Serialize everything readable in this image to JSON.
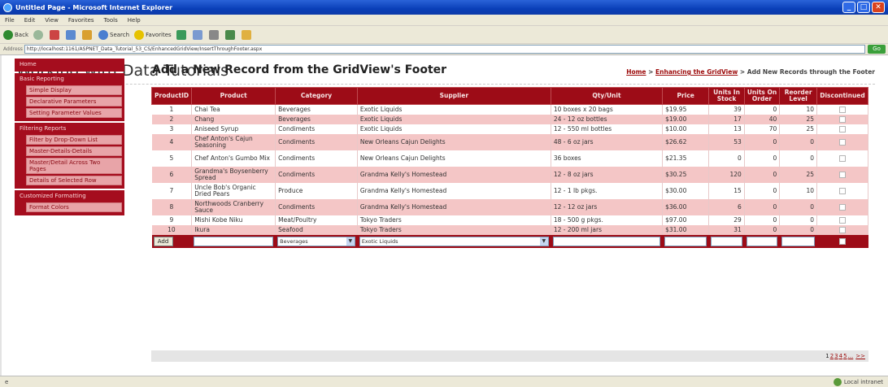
{
  "window": {
    "title": "Untitled Page - Microsoft Internet Explorer"
  },
  "menu": [
    "File",
    "Edit",
    "View",
    "Favorites",
    "Tools",
    "Help"
  ],
  "toolbar": {
    "back": "Back",
    "search": "Search",
    "favorites": "Favorites"
  },
  "address": {
    "label": "Address",
    "url": "http://localhost:1161/ASPNET_Data_Tutorial_53_CS/EnhancedGridView/InsertThroughFooter.aspx",
    "go": "Go"
  },
  "site": {
    "title": "Working with Data Tutorials"
  },
  "breadcrumb": {
    "home": "Home",
    "sep1": " > ",
    "section": "Enhancing the GridView",
    "sep2": " > ",
    "current": "Add New Records through the Footer"
  },
  "sidebar": [
    {
      "label": "Home",
      "children": []
    },
    {
      "label": "Basic Reporting",
      "children": [
        "Simple Display",
        "Declarative Parameters",
        "Setting Parameter Values"
      ]
    },
    {
      "label": "Filtering Reports",
      "children": [
        "Filter by Drop-Down List",
        "Master-Details-Details",
        "Master/Detail Across Two Pages",
        "Details of Selected Row"
      ]
    },
    {
      "label": "Customized Formatting",
      "children": [
        "Format Colors"
      ]
    }
  ],
  "page": {
    "heading": "Add a New Record from the GridView's Footer"
  },
  "grid": {
    "columns": [
      "ProductID",
      "Product",
      "Category",
      "Supplier",
      "Qty/Unit",
      "Price",
      "Units In Stock",
      "Units On Order",
      "Reorder Level",
      "Discontinued"
    ],
    "rows": [
      [
        "1",
        "Chai Tea",
        "Beverages",
        "Exotic Liquids",
        "10 boxes x 20 bags",
        "$19.95",
        "39",
        "0",
        "10"
      ],
      [
        "2",
        "Chang",
        "Beverages",
        "Exotic Liquids",
        "24 - 12 oz bottles",
        "$19.00",
        "17",
        "40",
        "25"
      ],
      [
        "3",
        "Aniseed Syrup",
        "Condiments",
        "Exotic Liquids",
        "12 - 550 ml bottles",
        "$10.00",
        "13",
        "70",
        "25"
      ],
      [
        "4",
        "Chef Anton's Cajun Seasoning",
        "Condiments",
        "New Orleans Cajun Delights",
        "48 - 6 oz jars",
        "$26.62",
        "53",
        "0",
        "0"
      ],
      [
        "5",
        "Chef Anton's Gumbo Mix",
        "Condiments",
        "New Orleans Cajun Delights",
        "36 boxes",
        "$21.35",
        "0",
        "0",
        "0"
      ],
      [
        "6",
        "Grandma's Boysenberry Spread",
        "Condiments",
        "Grandma Kelly's Homestead",
        "12 - 8 oz jars",
        "$30.25",
        "120",
        "0",
        "25"
      ],
      [
        "7",
        "Uncle Bob's Organic Dried Pears",
        "Produce",
        "Grandma Kelly's Homestead",
        "12 - 1 lb pkgs.",
        "$30.00",
        "15",
        "0",
        "10"
      ],
      [
        "8",
        "Northwoods Cranberry Sauce",
        "Condiments",
        "Grandma Kelly's Homestead",
        "12 - 12 oz jars",
        "$36.00",
        "6",
        "0",
        "0"
      ],
      [
        "9",
        "Mishi Kobe Niku",
        "Meat/Poultry",
        "Tokyo Traders",
        "18 - 500 g pkgs.",
        "$97.00",
        "29",
        "0",
        "0"
      ],
      [
        "10",
        "Ikura",
        "Seafood",
        "Tokyo Traders",
        "12 - 200 ml jars",
        "$31.00",
        "31",
        "0",
        "0"
      ]
    ],
    "footer": {
      "add_label": "Add",
      "category_selected": "Beverages",
      "supplier_selected": "Exotic Liquids"
    }
  },
  "pager": {
    "pages": [
      "1",
      "2",
      "3",
      "4",
      "5",
      "..."
    ],
    "next": ">>"
  },
  "status": {
    "zone": "Local intranet"
  },
  "colors": {
    "header_red": "#9d0c17",
    "alt_row": "#f4c6c6",
    "link": "#9c0a0a"
  }
}
